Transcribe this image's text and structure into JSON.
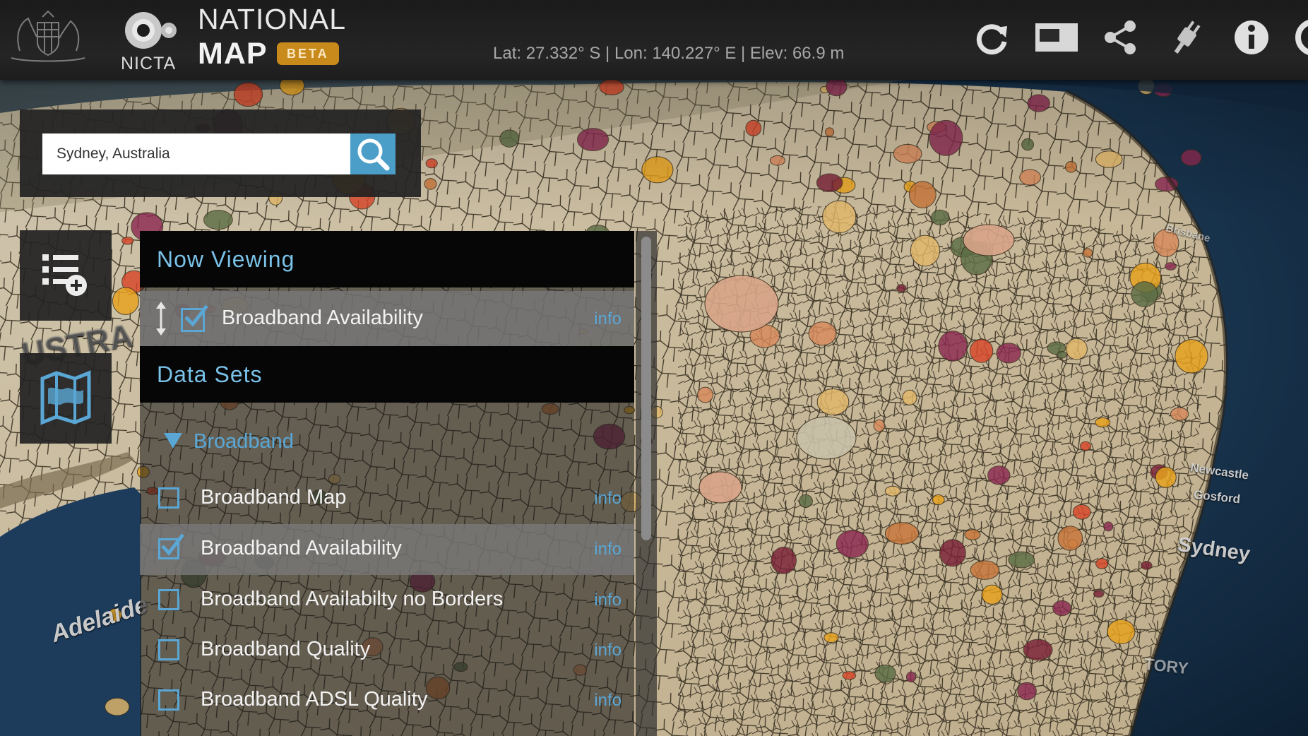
{
  "header": {
    "brand": {
      "nicta": "NICTA",
      "national": "NATIONAL",
      "map": "MAP",
      "beta": "BETA"
    },
    "coords": "Lat: 27.332° S | Lon: 140.227° E | Elev: 66.9 m",
    "icons": [
      "refresh-icon",
      "fullscreen-icon",
      "share-icon",
      "plugin-icon",
      "info-icon",
      "settings-icon"
    ]
  },
  "search": {
    "value": "Sydney, Australia"
  },
  "now_viewing": {
    "title": "Now Viewing",
    "items": [
      {
        "label": "Broadband Availability",
        "checked": true,
        "info": "info"
      }
    ]
  },
  "data_sets": {
    "title": "Data Sets",
    "group": "Broadband",
    "items": [
      {
        "label": "Broadband Map",
        "checked": false,
        "info": "info"
      },
      {
        "label": "Broadband Availability",
        "checked": true,
        "info": "info"
      },
      {
        "label": "Broadband Availabilty no Borders",
        "checked": false,
        "info": "info"
      },
      {
        "label": "Broadband Quality",
        "checked": false,
        "info": "info"
      },
      {
        "label": "Broadband ADSL Quality",
        "checked": false,
        "info": "info"
      }
    ]
  },
  "map_labels": {
    "sydney": "Sydney",
    "newcastle": "Newcastle",
    "gosford": "Gosford",
    "territory": "TORY",
    "adelaide": "Adelaide",
    "australia": "USTRA",
    "brisbane": "Brisbane"
  },
  "colors": {
    "accent": "#5aa7d6",
    "beta": "#c98a1c",
    "land": "#cfc3a8",
    "ocean": "#16314c"
  }
}
